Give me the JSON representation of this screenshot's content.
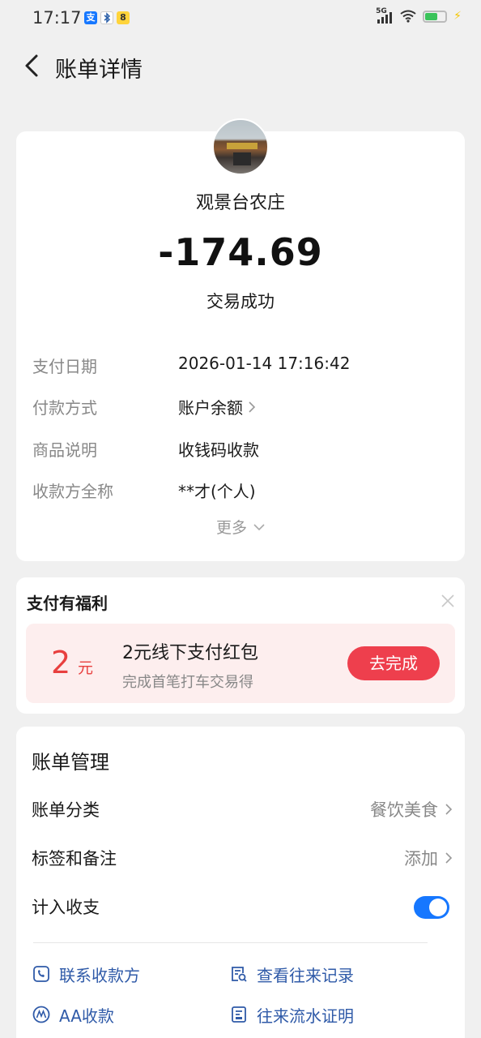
{
  "status_bar": {
    "time": "17:17",
    "network": "5G",
    "battery_percent": 60,
    "app_icons": [
      "alipay-icon",
      "bluetooth-app-icon",
      "yellow-app-icon"
    ],
    "app_glyphs": [
      "支",
      "",
      "8"
    ]
  },
  "header": {
    "title": "账单详情"
  },
  "bill": {
    "merchant": "观景台农庄",
    "amount": "-174.69",
    "status": "交易成功",
    "details": [
      {
        "label": "支付日期",
        "value": "2026-01-14 17:16:42"
      },
      {
        "label": "付款方式",
        "value": "账户余额"
      },
      {
        "label": "商品说明",
        "value": "收钱码收款"
      },
      {
        "label": "收款方全称",
        "value": "**才(个人)"
      }
    ],
    "more": "更多"
  },
  "benefit": {
    "title": "支付有福利",
    "coupon_amount": "2",
    "coupon_unit": "元",
    "coupon_title": "2元线下支付红包",
    "coupon_subtitle": "完成首笔打车交易得",
    "button": "去完成"
  },
  "manage": {
    "title": "账单管理",
    "rows": [
      {
        "label": "账单分类",
        "value": "餐饮美食"
      },
      {
        "label": "标签和备注",
        "value": "添加"
      },
      {
        "label": "计入收支",
        "toggle_on": true
      }
    ],
    "links": [
      {
        "label": "联系收款方",
        "icon": "contact-icon"
      },
      {
        "label": "查看往来记录",
        "icon": "records-icon"
      },
      {
        "label": "AA收款",
        "icon": "aa-icon"
      },
      {
        "label": "往来流水证明",
        "icon": "certificate-icon"
      }
    ]
  },
  "colors": {
    "accent_blue": "#1677ff",
    "link_blue": "#2f5aa8",
    "coupon_red": "#e8403f",
    "button_red": "#ee3f4d"
  }
}
